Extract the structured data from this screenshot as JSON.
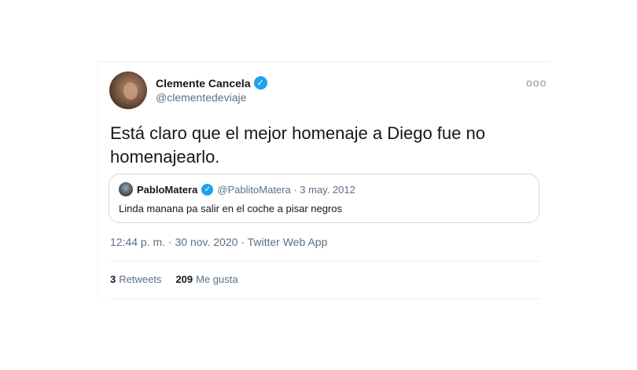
{
  "author": {
    "display_name": "Clemente Cancela",
    "handle": "@clementedeviaje"
  },
  "tweet": {
    "text": "Está claro que el mejor homenaje a Diego fue no homenajearlo."
  },
  "quoted_tweet": {
    "display_name": "PabloMatera",
    "meta": "@PablitoMatera · 3 may. 2012",
    "text": "Linda manana pa salir en el coche a pisar negros"
  },
  "meta": {
    "timestamp": "12:44 p. m. · 30 nov. 2020 · Twitter Web App"
  },
  "stats": {
    "retweets_count": "3",
    "retweets_label": "Retweets",
    "likes_count": "209",
    "likes_label": "Me gusta"
  },
  "icons": {
    "verified": "verified-badge-icon",
    "more": "more-options-icon"
  },
  "colors": {
    "verified_blue": "#1da1f2",
    "secondary_text": "#5b7083",
    "primary_text": "#14171a",
    "border": "#cfd9de"
  }
}
